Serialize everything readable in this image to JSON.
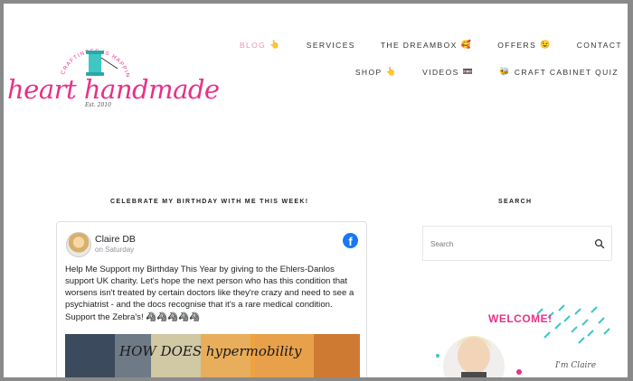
{
  "logo": {
    "title": "heart handmade",
    "tagline": "CRAFTINESS IS HAPPINESS",
    "est": "Est. 2010"
  },
  "nav": {
    "row1": [
      {
        "label": "BLOG",
        "emoji": "👆",
        "active": true
      },
      {
        "label": "SERVICES",
        "emoji": ""
      },
      {
        "label": "THE DREAMBOX",
        "emoji": "🥰"
      },
      {
        "label": "OFFERS",
        "emoji": "😉"
      },
      {
        "label": "CONTACT",
        "emoji": ""
      }
    ],
    "row2": [
      {
        "label": "SHOP",
        "emoji": "👆"
      },
      {
        "label": "VIDEOS",
        "emoji": "📼"
      },
      {
        "label": "CRAFT CABINET QUIZ",
        "emoji": "🐝",
        "emoji_before": true
      }
    ]
  },
  "main": {
    "section_title": "CELEBRATE MY BIRTHDAY WITH ME THIS WEEK!",
    "post": {
      "author": "Claire DB",
      "time": "on Saturday",
      "paragraph1": "Help Me Support my Birthday This Year by giving to the Ehlers-Danlos support UK charity. Let's hope the next person who has this condition that worsens isn't treated by certain doctors like they're crazy and need to see a psychiatrist - and the docs recognise that it's a rare medical condition.",
      "paragraph2": "Support the Zebra's! 🦓🦓🦓🦓🦓",
      "image_caption": "HOW DOES hypermobility"
    }
  },
  "sidebar": {
    "search_title": "SEARCH",
    "search_placeholder": "Search",
    "welcome": "WELCOME!",
    "signature": "I'm Claire"
  },
  "colors": {
    "brand_pink": "#e8308a",
    "nav_active": "#f08fb0",
    "facebook_blue": "#1877f2",
    "teal": "#3fc7c3"
  }
}
